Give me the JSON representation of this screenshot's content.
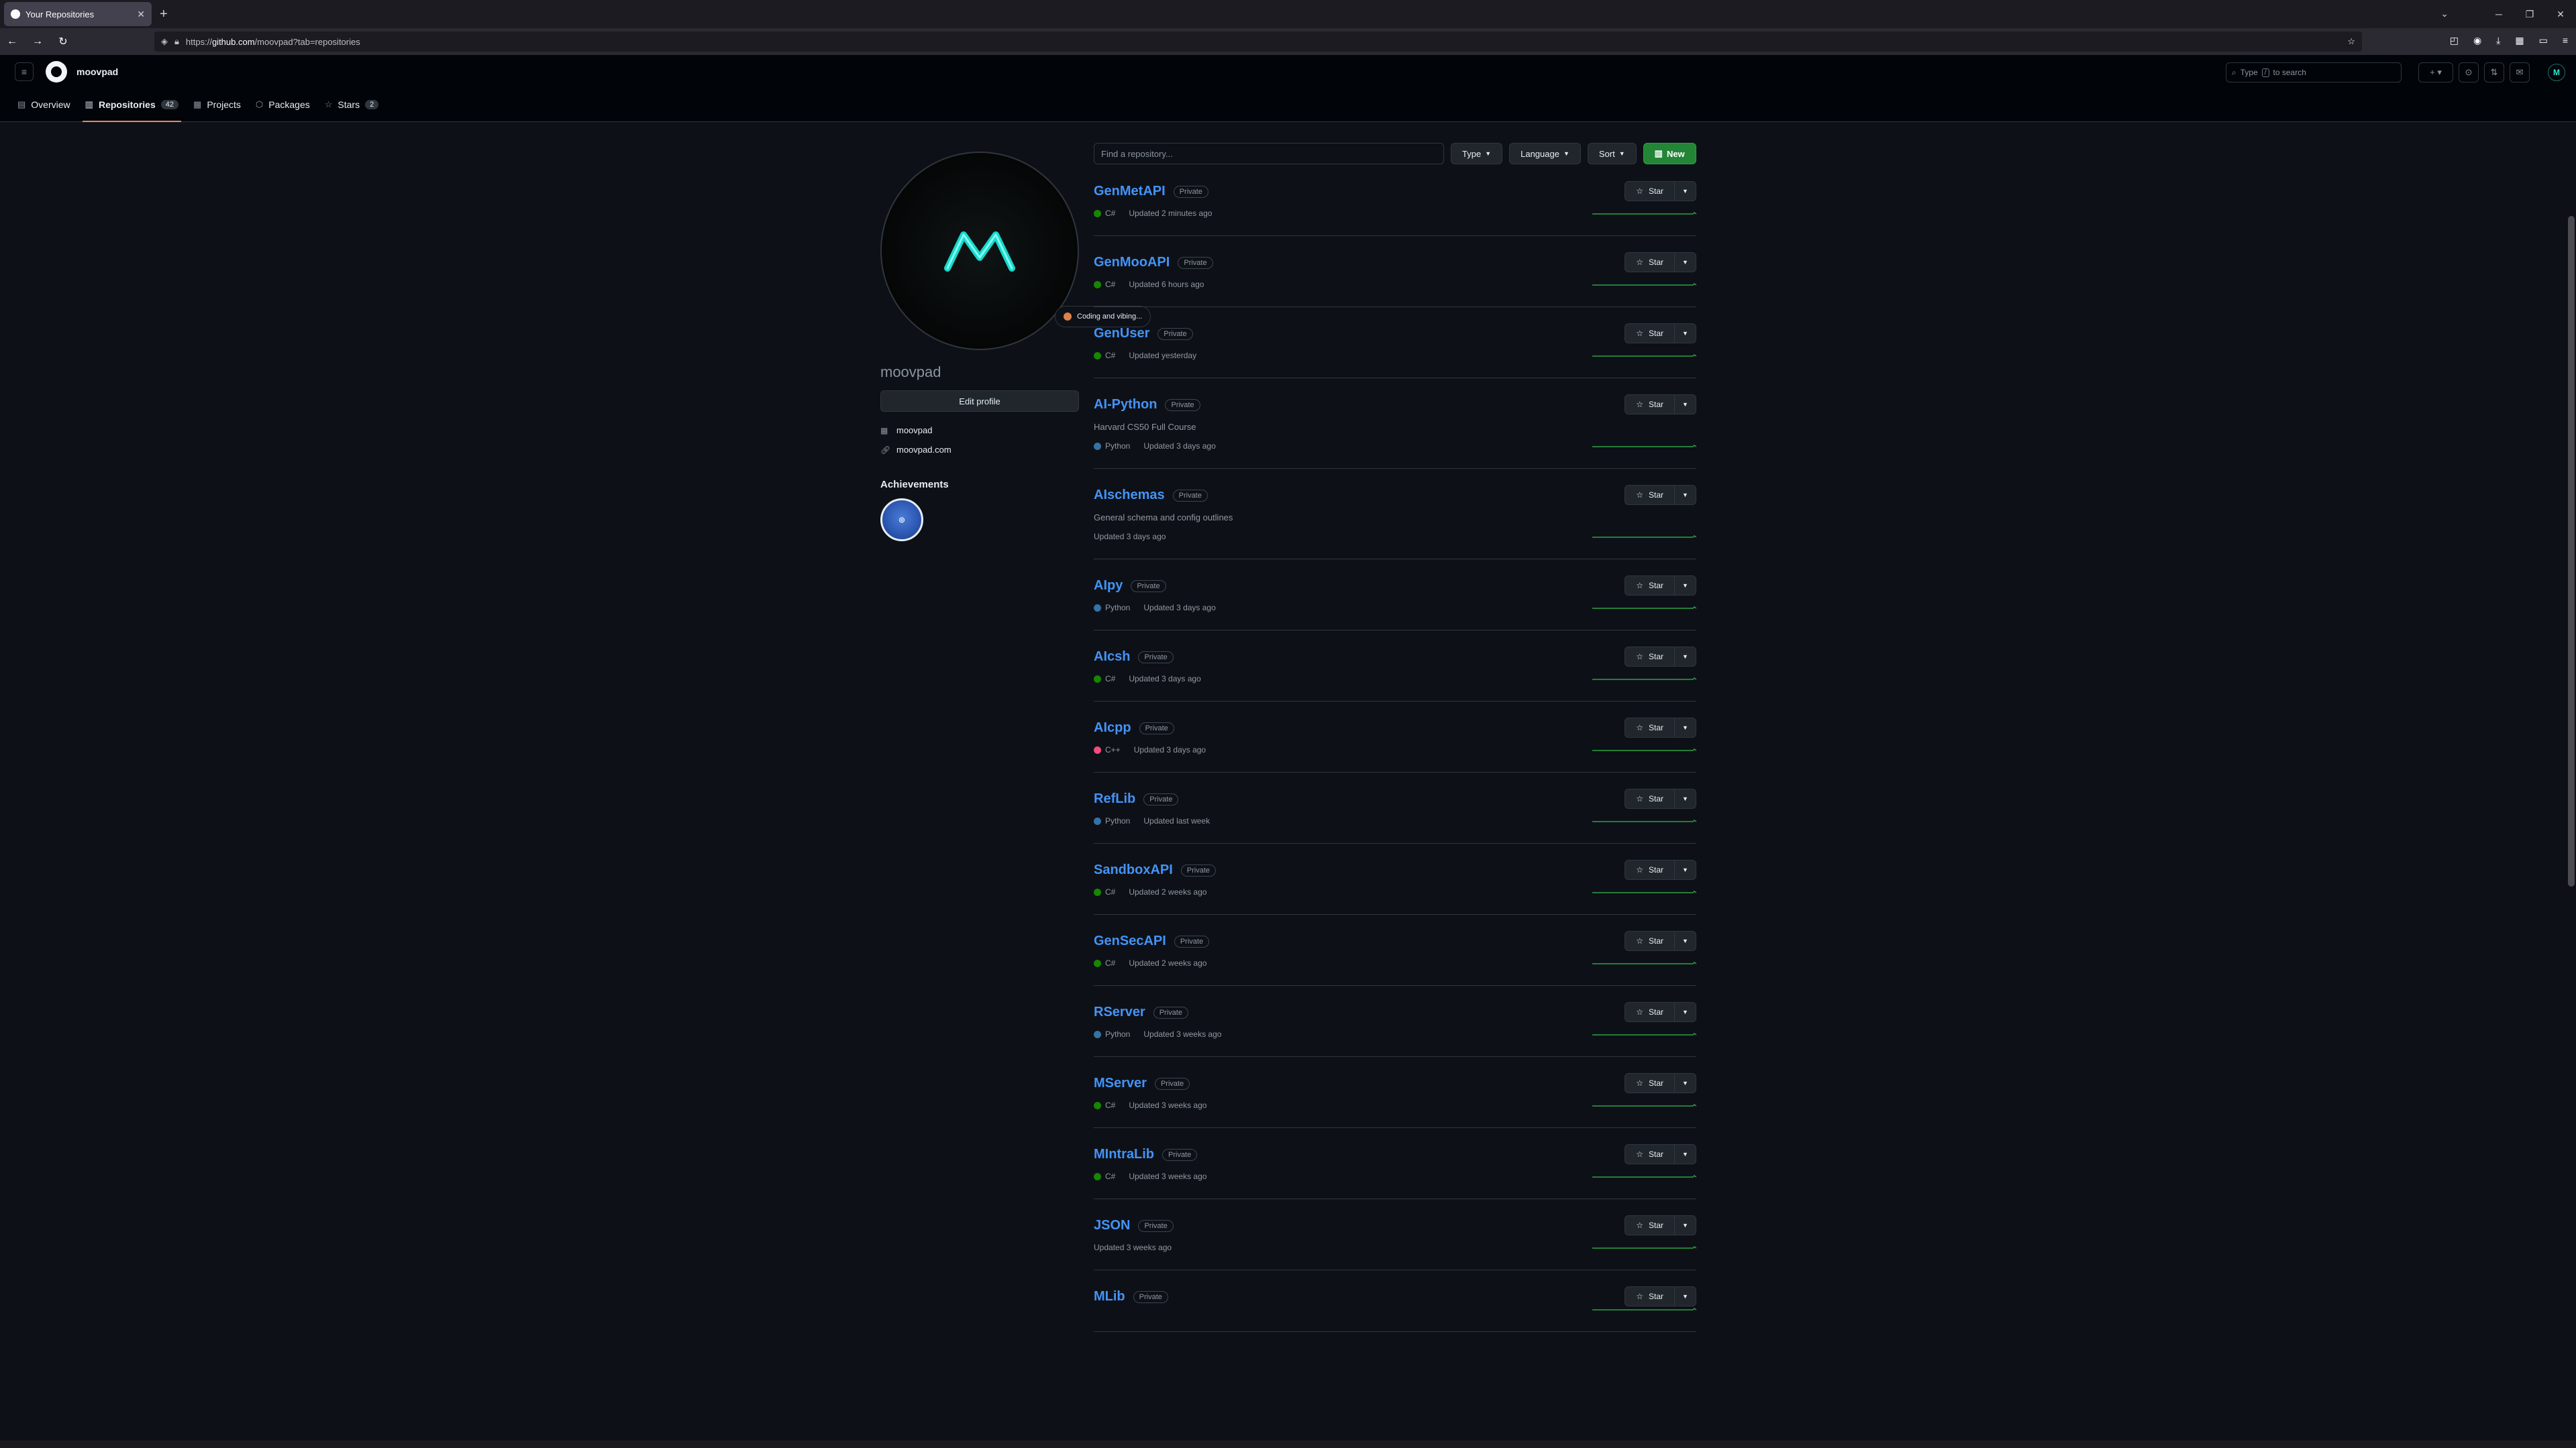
{
  "browser": {
    "tab_title": "Your Repositories",
    "url_prefix": "https://",
    "url_host": "github.com",
    "url_path": "/moovpad?tab=repositories"
  },
  "header": {
    "username": "moovpad",
    "search_prefix": "Type",
    "search_key": "/",
    "search_suffix": "to search"
  },
  "subnav": [
    {
      "label": "Overview",
      "icon": "book-icon"
    },
    {
      "label": "Repositories",
      "icon": "repo-icon",
      "count": "42",
      "active": true
    },
    {
      "label": "Projects",
      "icon": "table-icon"
    },
    {
      "label": "Packages",
      "icon": "package-icon"
    },
    {
      "label": "Stars",
      "icon": "star-icon",
      "count": "2"
    }
  ],
  "profile": {
    "status": "Coding and vibing...",
    "name": "moovpad",
    "edit_label": "Edit profile",
    "org": "moovpad",
    "website": "moovpad.com",
    "achievements_title": "Achievements"
  },
  "filters": {
    "find_placeholder": "Find a repository...",
    "type": "Type",
    "language": "Language",
    "sort": "Sort",
    "new": "New"
  },
  "colors": {
    "csharp": "#178600",
    "python": "#3572A5",
    "cpp": "#f34b7d",
    "accent": "#4493f8"
  },
  "repos": [
    {
      "name": "GenMetAPI",
      "visibility": "Private",
      "desc": "",
      "lang": "C#",
      "langColor": "#178600",
      "updated": "Updated 2 minutes ago",
      "star": "Star"
    },
    {
      "name": "GenMooAPI",
      "visibility": "Private",
      "desc": "",
      "lang": "C#",
      "langColor": "#178600",
      "updated": "Updated 6 hours ago",
      "star": "Star"
    },
    {
      "name": "GenUser",
      "visibility": "Private",
      "desc": "",
      "lang": "C#",
      "langColor": "#178600",
      "updated": "Updated yesterday",
      "star": "Star"
    },
    {
      "name": "AI-Python",
      "visibility": "Private",
      "desc": "Harvard CS50 Full Course",
      "lang": "Python",
      "langColor": "#3572A5",
      "updated": "Updated 3 days ago",
      "star": "Star"
    },
    {
      "name": "AIschemas",
      "visibility": "Private",
      "desc": "General schema and config outlines",
      "lang": "",
      "langColor": "",
      "updated": "Updated 3 days ago",
      "star": "Star"
    },
    {
      "name": "AIpy",
      "visibility": "Private",
      "desc": "",
      "lang": "Python",
      "langColor": "#3572A5",
      "updated": "Updated 3 days ago",
      "star": "Star"
    },
    {
      "name": "AIcsh",
      "visibility": "Private",
      "desc": "",
      "lang": "C#",
      "langColor": "#178600",
      "updated": "Updated 3 days ago",
      "star": "Star"
    },
    {
      "name": "AIcpp",
      "visibility": "Private",
      "desc": "",
      "lang": "C++",
      "langColor": "#f34b7d",
      "updated": "Updated 3 days ago",
      "star": "Star"
    },
    {
      "name": "RefLib",
      "visibility": "Private",
      "desc": "",
      "lang": "Python",
      "langColor": "#3572A5",
      "updated": "Updated last week",
      "star": "Star"
    },
    {
      "name": "SandboxAPI",
      "visibility": "Private",
      "desc": "",
      "lang": "C#",
      "langColor": "#178600",
      "updated": "Updated 2 weeks ago",
      "star": "Star"
    },
    {
      "name": "GenSecAPI",
      "visibility": "Private",
      "desc": "",
      "lang": "C#",
      "langColor": "#178600",
      "updated": "Updated 2 weeks ago",
      "star": "Star"
    },
    {
      "name": "RServer",
      "visibility": "Private",
      "desc": "",
      "lang": "Python",
      "langColor": "#3572A5",
      "updated": "Updated 3 weeks ago",
      "star": "Star"
    },
    {
      "name": "MServer",
      "visibility": "Private",
      "desc": "",
      "lang": "C#",
      "langColor": "#178600",
      "updated": "Updated 3 weeks ago",
      "star": "Star"
    },
    {
      "name": "MIntraLib",
      "visibility": "Private",
      "desc": "",
      "lang": "C#",
      "langColor": "#178600",
      "updated": "Updated 3 weeks ago",
      "star": "Star"
    },
    {
      "name": "JSON",
      "visibility": "Private",
      "desc": "",
      "lang": "",
      "langColor": "",
      "updated": "Updated 3 weeks ago",
      "star": "Star"
    },
    {
      "name": "MLib",
      "visibility": "Private",
      "desc": "",
      "lang": "",
      "langColor": "",
      "updated": "",
      "star": "Star"
    }
  ]
}
